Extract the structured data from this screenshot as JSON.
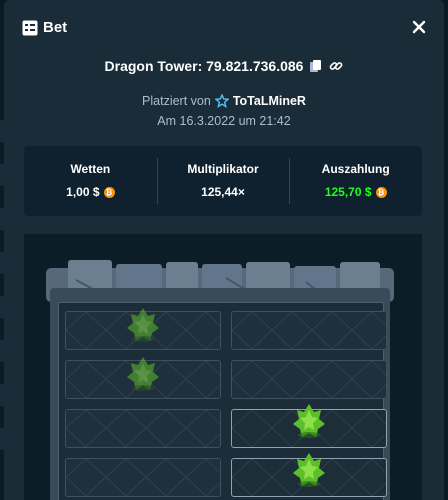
{
  "modal": {
    "title": "Bet",
    "bet_id": "Dragon Tower: 79.821.736.086",
    "placed_by_prefix": "Platziert von",
    "placed_by_user": "ToTaLMineR",
    "date": "Am 16.3.2022 um 21:42"
  },
  "stats": {
    "wager_label": "Wetten",
    "wager_value": "1,00 $",
    "multiplier_label": "Multiplikator",
    "multiplier_value": "125,44×",
    "payout_label": "Auszahlung",
    "payout_value": "125,70 $"
  },
  "colors": {
    "background": "#1a2c38",
    "panel": "#0f212e",
    "payout_green": "#1fff20",
    "currency_coin": "#f7931a",
    "egg_green": "#5bbf2a"
  },
  "icons": {
    "header": "bet-list-icon",
    "copy": "copy-icon",
    "link": "link-icon",
    "user_badge": "star-badge-icon",
    "close": "close-icon",
    "currency": "bitcoin-coin-icon",
    "egg": "dragon-egg-icon"
  },
  "board": {
    "rows": [
      {
        "left_has_egg": true,
        "right_has_egg": false,
        "revealed_side": "none"
      },
      {
        "left_has_egg": true,
        "right_has_egg": false,
        "revealed_side": "none"
      },
      {
        "left_has_egg": false,
        "right_has_egg": true,
        "revealed_side": "right"
      },
      {
        "left_has_egg": false,
        "right_has_egg": true,
        "revealed_side": "right"
      }
    ]
  }
}
